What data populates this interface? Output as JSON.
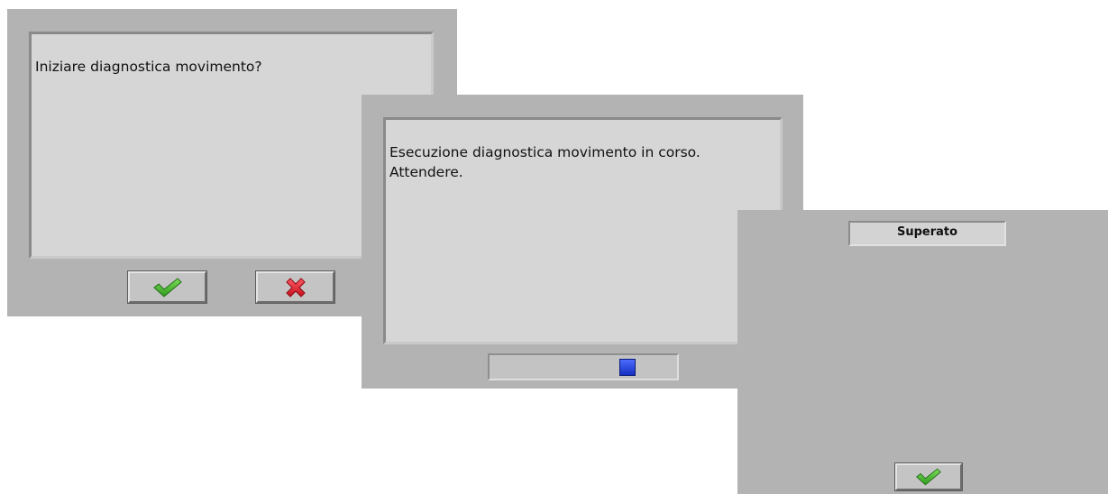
{
  "start_dialog": {
    "message": "Iniziare diagnostica movimento?",
    "confirm_icon": "check-icon",
    "cancel_icon": "cross-icon"
  },
  "progress_dialog": {
    "message": "Esecuzione diagnostica movimento in corso.\nAttendere.",
    "indicator_icon": "progress-block-icon"
  },
  "result_dialog": {
    "result_label": "Superato",
    "confirm_icon": "check-icon"
  },
  "colors": {
    "dialog_bg": "#b3b3b3",
    "panel_bg": "#d6d6d6",
    "check_green": "#3fae2e",
    "cross_red": "#d9202a",
    "progress_blue": "#1f3fd6"
  }
}
